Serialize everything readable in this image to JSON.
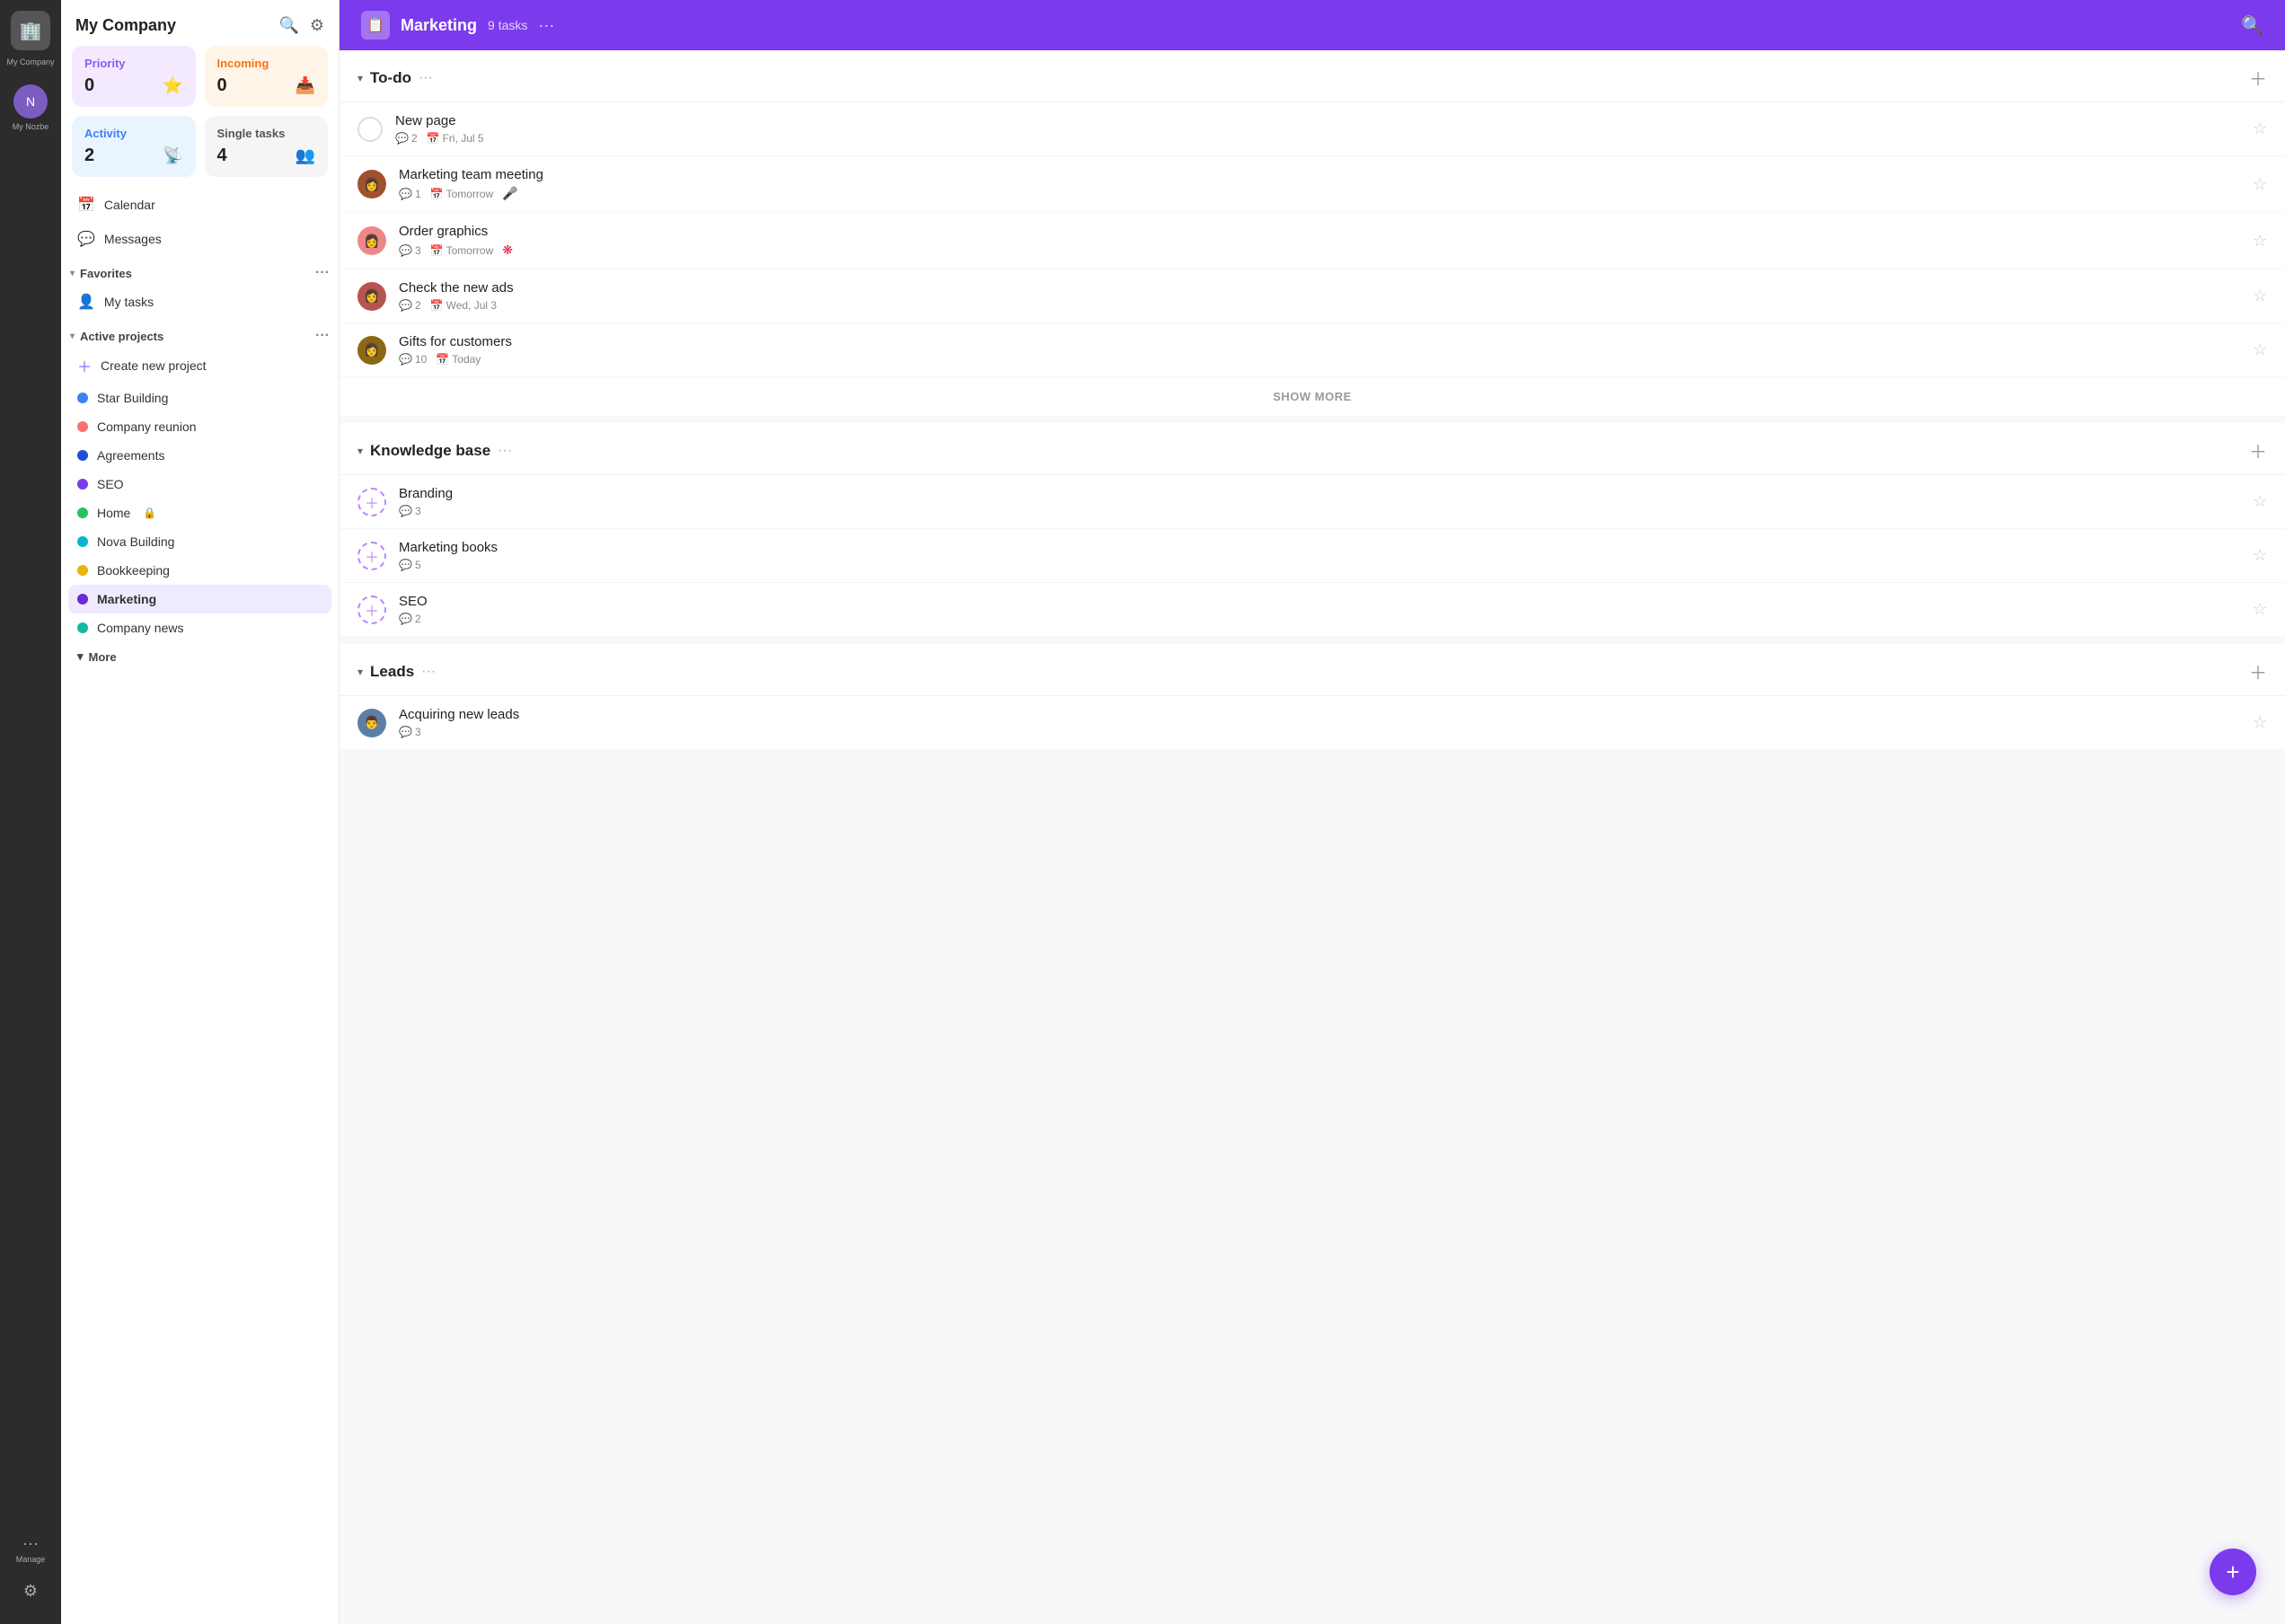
{
  "app": {
    "company": "My Company",
    "icon": "🏢"
  },
  "icon_bar": {
    "logo_icon": "🏢",
    "my_nozbe_label": "My Nozbe",
    "manage_label": "Manage",
    "settings_label": "Settings"
  },
  "sidebar": {
    "title": "My Company",
    "search_icon": "🔍",
    "settings_icon": "⚙",
    "cards": [
      {
        "id": "priority",
        "label": "Priority",
        "value": "0",
        "icon": "⭐",
        "type": "priority"
      },
      {
        "id": "incoming",
        "label": "Incoming",
        "value": "0",
        "icon": "📥",
        "type": "incoming"
      },
      {
        "id": "activity",
        "label": "Activity",
        "value": "2",
        "icon": "📡",
        "type": "activity"
      },
      {
        "id": "single",
        "label": "Single tasks",
        "value": "4",
        "icon": "👥",
        "type": "single"
      }
    ],
    "nav": [
      {
        "label": "Calendar",
        "icon": "📅"
      },
      {
        "label": "Messages",
        "icon": "💬"
      }
    ],
    "favorites_label": "Favorites",
    "favorites_items": [
      {
        "label": "My tasks",
        "icon": "👤"
      }
    ],
    "active_projects_label": "Active projects",
    "projects": [
      {
        "label": "Create new project",
        "dot_color": "purple-plus",
        "is_create": true
      },
      {
        "label": "Star Building",
        "dot_color": "blue"
      },
      {
        "label": "Company reunion",
        "dot_color": "salmon"
      },
      {
        "label": "Agreements",
        "dot_color": "dark-blue"
      },
      {
        "label": "SEO",
        "dot_color": "violet"
      },
      {
        "label": "Home",
        "dot_color": "green",
        "lock": true
      },
      {
        "label": "Nova Building",
        "dot_color": "cyan"
      },
      {
        "label": "Bookkeeping",
        "dot_color": "yellow"
      },
      {
        "label": "Marketing",
        "dot_color": "dark-purple",
        "active": true
      },
      {
        "label": "Company news",
        "dot_color": "teal"
      }
    ],
    "more_label": "More"
  },
  "main": {
    "header": {
      "logo_icon": "📋",
      "title": "Marketing",
      "tasks_count": "9 tasks",
      "more_icon": "···"
    },
    "sections": [
      {
        "id": "todo",
        "title": "To-do",
        "tasks": [
          {
            "id": "new-page",
            "title": "New page",
            "comments": "2",
            "date": "Fri, Jul 5",
            "has_avatar": false,
            "avatar_type": "checkbox"
          },
          {
            "id": "marketing-meeting",
            "title": "Marketing team meeting",
            "comments": "1",
            "date": "Tomorrow",
            "has_avatar": true,
            "avatar_type": "brown",
            "special_icon": "🎤"
          },
          {
            "id": "order-graphics",
            "title": "Order graphics",
            "comments": "3",
            "date": "Tomorrow",
            "has_avatar": true,
            "avatar_type": "pink",
            "special_icon": "❋"
          },
          {
            "id": "check-new-ads",
            "title": "Check the new ads",
            "comments": "2",
            "date": "Wed, Jul 3",
            "has_avatar": true,
            "avatar_type": "red-brown",
            "special_icon": ""
          },
          {
            "id": "gifts-customers",
            "title": "Gifts for customers",
            "comments": "10",
            "date": "Today",
            "has_avatar": true,
            "avatar_type": "dark-hair",
            "special_icon": ""
          }
        ],
        "show_more": true
      },
      {
        "id": "knowledge-base",
        "title": "Knowledge base",
        "tasks": [
          {
            "id": "branding",
            "title": "Branding",
            "comments": "3",
            "date": "",
            "has_avatar": false,
            "avatar_type": "plus"
          },
          {
            "id": "marketing-books",
            "title": "Marketing books",
            "comments": "5",
            "date": "",
            "has_avatar": false,
            "avatar_type": "plus"
          },
          {
            "id": "seo",
            "title": "SEO",
            "comments": "2",
            "date": "",
            "has_avatar": false,
            "avatar_type": "plus"
          }
        ],
        "show_more": false
      },
      {
        "id": "leads",
        "title": "Leads",
        "tasks": [
          {
            "id": "acquiring-leads",
            "title": "Acquiring new leads",
            "comments": "3",
            "date": "",
            "has_avatar": true,
            "avatar_type": "male"
          }
        ],
        "show_more": false
      }
    ],
    "show_more_label": "SHOW MORE",
    "fab_icon": "+"
  }
}
